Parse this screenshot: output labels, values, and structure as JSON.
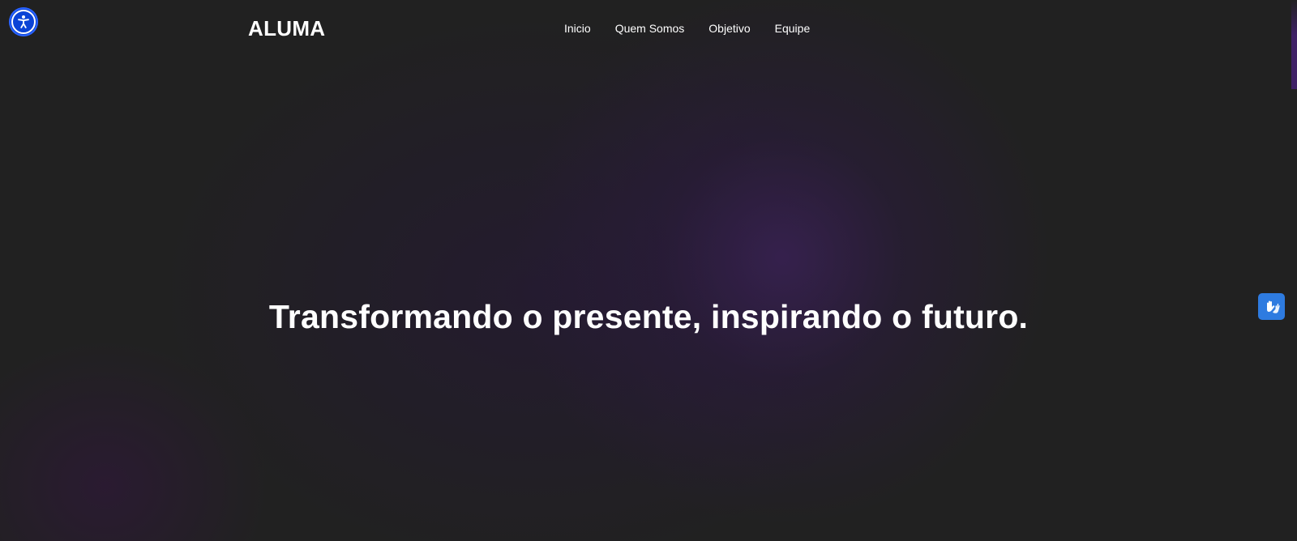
{
  "header": {
    "logo": "ALUMA",
    "nav": [
      {
        "label": "Inicio"
      },
      {
        "label": "Quem Somos"
      },
      {
        "label": "Objetivo"
      },
      {
        "label": "Equipe"
      }
    ]
  },
  "hero": {
    "title": "Transformando o presente, inspirando o futuro."
  },
  "widgets": {
    "accessibility_icon": "accessibility-person-icon",
    "vlibras_icon": "sign-language-hands-icon"
  },
  "colors": {
    "background": "#212121",
    "accent_purple": "#3c215a",
    "accessibility_blue": "#0b43d6",
    "vlibras_blue": "#2e7be0",
    "text": "#ffffff"
  }
}
